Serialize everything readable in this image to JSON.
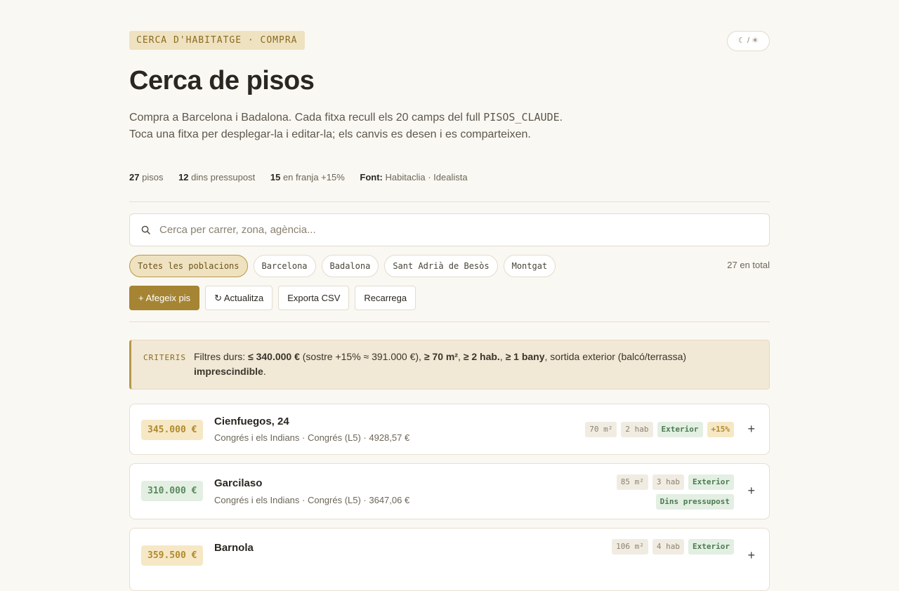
{
  "header": {
    "eyebrow": "CERCA D'HABITATGE · COMPRA",
    "theme_toggle": "☾ / ☀",
    "title": "Cerca de pisos",
    "desc_pre": "Compra a Barcelona i Badalona. Cada fitxa recull els 20 camps del full ",
    "desc_code": "PISOS_CLAUDE",
    "desc_post": ". Toca una fitxa per desplegar-la i editar-la; els canvis es desen i es comparteixen."
  },
  "stats": {
    "pisos_count": "27",
    "pisos_label": "pisos",
    "budget_count": "12",
    "budget_label": "dins pressupost",
    "range_count": "15",
    "range_label": "en franja +15%",
    "source_label": "Font:",
    "source_value": "Habitaclia · Idealista"
  },
  "search": {
    "placeholder": "Cerca per carrer, zona, agència..."
  },
  "filters": {
    "items": [
      "Totes les poblacions",
      "Barcelona",
      "Badalona",
      "Sant Adrià de Besòs",
      "Montgat"
    ],
    "total": "27 en total"
  },
  "actions": {
    "add": "+ Afegeix pis",
    "refresh": "↻ Actualitza",
    "export": "Exporta CSV",
    "reload": "Recarrega"
  },
  "criteria": {
    "tag": "CRITERIS",
    "t1": "Filtres durs: ",
    "b1": "≤ 340.000 €",
    "t2": " (sostre +15% ≈ 391.000 €), ",
    "b2": "≥ 70 m²",
    "t3": ", ",
    "b3": "≥ 2 hab.",
    "t4": ", ",
    "b4": "≥ 1 bany",
    "t5": ", sortida exterior (balcó/terrassa) ",
    "b5": "imprescindible",
    "t6": "."
  },
  "listings": [
    {
      "price": "345.000 €",
      "address": "Cienfuegos, 24",
      "meta": "Congrés i els Indians · Congrés (L5) · 4928,57 €",
      "tags": [
        "70 m²",
        "2 hab",
        "Exterior",
        "+15%"
      ]
    },
    {
      "price": "310.000 €",
      "address": "Garcilaso",
      "meta": "Congrés i els Indians · Congrés (L5) · 3647,06 €",
      "tags": [
        "85 m²",
        "3 hab",
        "Exterior",
        "Dins pressupost"
      ]
    },
    {
      "price": "359.500 €",
      "address": "Barnola",
      "meta": "",
      "tags": [
        "106 m²",
        "4 hab",
        "Exterior"
      ]
    }
  ],
  "colors": {
    "accent": "#a58433",
    "over_budget": "#b08a2e",
    "in_budget": "#5b8a5e",
    "background": "#faf8f3"
  },
  "icons": {
    "search": "search-icon",
    "expand": "plus-icon"
  }
}
